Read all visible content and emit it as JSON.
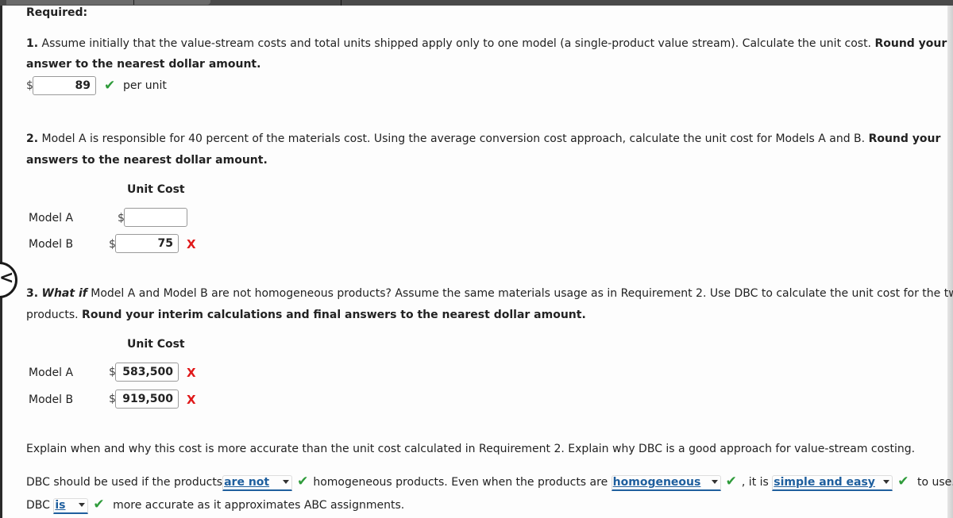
{
  "header": {
    "required_label": "Required:"
  },
  "q1": {
    "number": "1.",
    "text": " Assume initially that the value-stream costs and total units shipped apply only to one model (a single-product value stream). Calculate the unit cost. ",
    "bold_line1": "Round your",
    "bold_line2": "answer to the nearest dollar amount.",
    "currency": "$",
    "answer_value": "89",
    "answer_status": "correct",
    "unit_suffix": "per unit"
  },
  "q2": {
    "number": "2.",
    "text": " Model A is responsible for 40 percent of the materials cost. Using the average conversion cost approach, calculate the unit cost for Models A and B. ",
    "bold_line1": "Round your",
    "bold_line2": "answers to the nearest dollar amount.",
    "column_header": "Unit Cost",
    "rows": [
      {
        "label": "Model A",
        "currency": "$",
        "value": "",
        "status": "none"
      },
      {
        "label": "Model B",
        "currency": "$",
        "value": "75",
        "status": "incorrect"
      }
    ]
  },
  "q3": {
    "number": "3.",
    "what_if": "What if",
    "text": " Model A and Model B are not homogeneous products? Assume the same materials usage as in Requirement 2. Use DBC to calculate the unit cost for the two",
    "line2_plain": "products. ",
    "line2_bold": "Round your interim calculations and final answers to the nearest dollar amount.",
    "column_header": "Unit Cost",
    "rows": [
      {
        "label": "Model A",
        "currency": "$",
        "value": "583,500",
        "status": "incorrect"
      },
      {
        "label": "Model B",
        "currency": "$",
        "value": "919,500",
        "status": "incorrect"
      }
    ]
  },
  "explain": {
    "prompt": "Explain when and why this cost is more accurate than the unit cost calculated in Requirement 2. Explain why DBC is a good approach for value-stream costing.",
    "s1_pre": "DBC should be used if the products",
    "s1_select": "are not",
    "s1_mid": "homogeneous products. Even when the products are",
    "s1_select2": "homogeneous",
    "s1_mid2": ", it is",
    "s1_select3": "simple and easy",
    "s1_post": "to use.",
    "s2_pre": "DBC",
    "s2_select": "is",
    "s2_post": "more accurate as it approximates ABC assignments."
  },
  "icons": {
    "check": "✔",
    "x": "X",
    "chevron": "<"
  },
  "colors": {
    "correct": "#2e9b3a",
    "incorrect": "#e0191a",
    "select_text": "#1f5f9e"
  }
}
